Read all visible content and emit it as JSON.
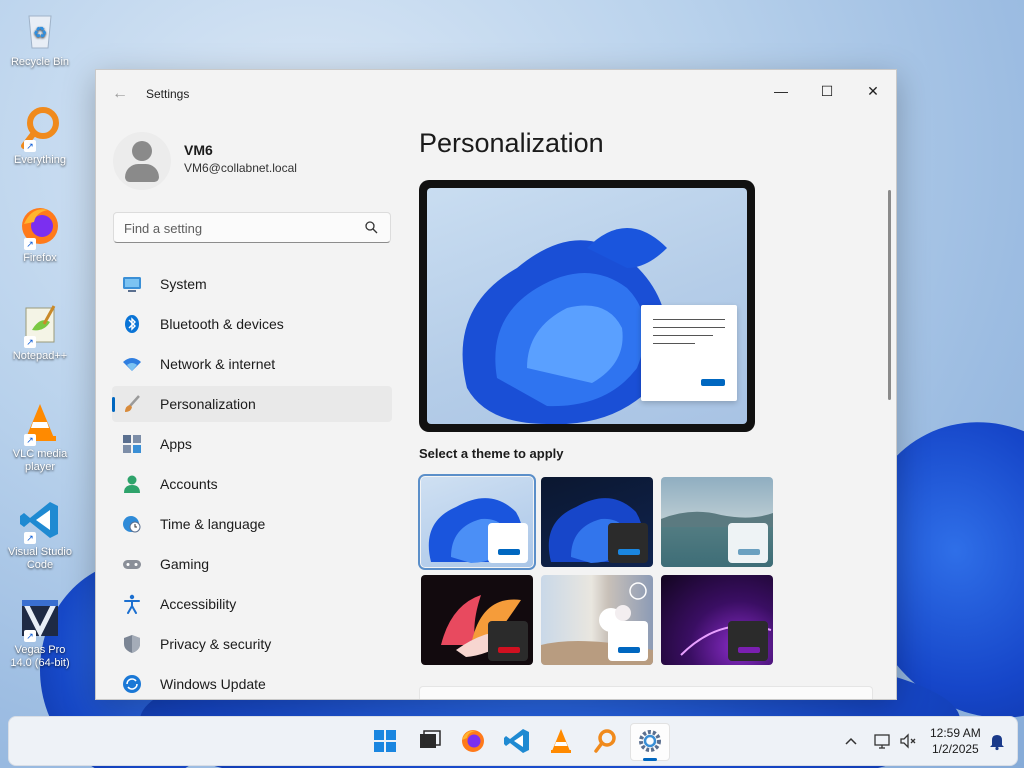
{
  "desktop": {
    "icons": [
      {
        "label": "Recycle Bin"
      },
      {
        "label": "Everything"
      },
      {
        "label": "Firefox"
      },
      {
        "label": "Notepad++"
      },
      {
        "label": "VLC media player"
      },
      {
        "label": "Visual Studio Code"
      },
      {
        "label": "Vegas Pro 14.0 (64-bit)"
      }
    ]
  },
  "window": {
    "title": "Settings",
    "controls": {
      "minimize": "—",
      "maximize": "☐",
      "close": "✕"
    }
  },
  "profile": {
    "name": "VM6",
    "email": "VM6@collabnet.local"
  },
  "search": {
    "placeholder": "Find a setting"
  },
  "nav": {
    "items": [
      {
        "label": "System",
        "icon": "system-icon",
        "color": "#3a8fd6"
      },
      {
        "label": "Bluetooth & devices",
        "icon": "bluetooth-icon",
        "color": "#0a74d6"
      },
      {
        "label": "Network & internet",
        "icon": "wifi-icon",
        "color": "#2f7ee0"
      },
      {
        "label": "Personalization",
        "icon": "brush-icon",
        "color": "#d88a3a",
        "active": true
      },
      {
        "label": "Apps",
        "icon": "apps-icon",
        "color": "#5a6f8f"
      },
      {
        "label": "Accounts",
        "icon": "accounts-icon",
        "color": "#2ea36b"
      },
      {
        "label": "Time & language",
        "icon": "globe-clock-icon",
        "color": "#2f8bd8"
      },
      {
        "label": "Gaming",
        "icon": "gamepad-icon",
        "color": "#8a8f98"
      },
      {
        "label": "Accessibility",
        "icon": "accessibility-icon",
        "color": "#1b6fd0"
      },
      {
        "label": "Privacy & security",
        "icon": "shield-icon",
        "color": "#7b8594"
      },
      {
        "label": "Windows Update",
        "icon": "update-icon",
        "color": "#1a78d6"
      }
    ]
  },
  "content": {
    "title": "Personalization",
    "themes_label": "Select a theme to apply",
    "accent": "#0067c0"
  },
  "taskbar": {
    "time": "12:59 AM",
    "date": "1/2/2025"
  }
}
